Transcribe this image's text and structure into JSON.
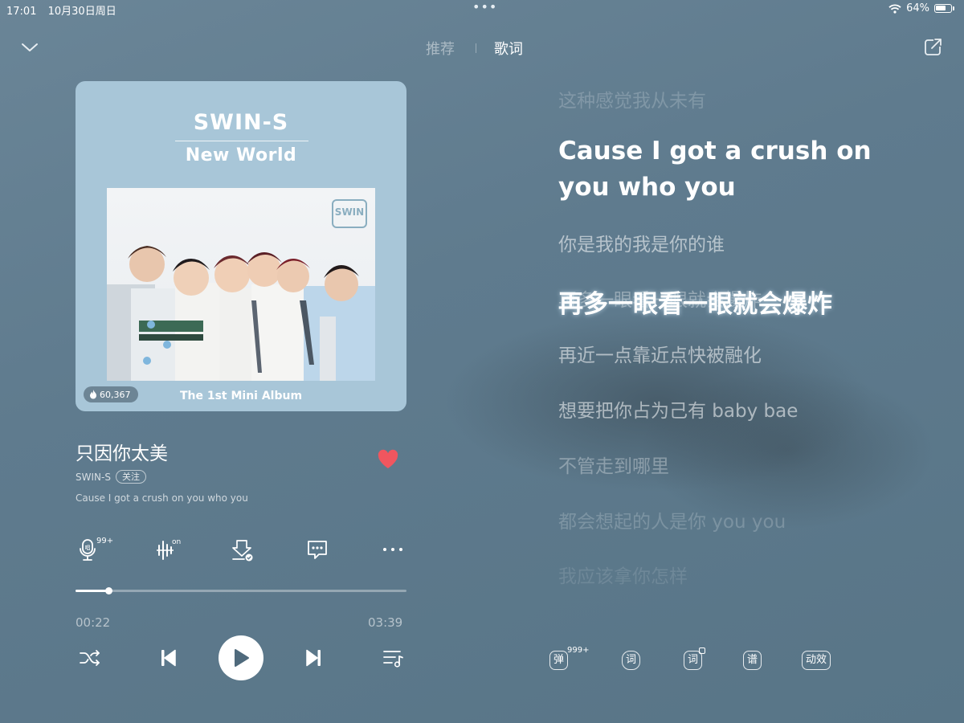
{
  "status_bar": {
    "time": "17:01",
    "date": "10月30日周日",
    "center_dots": "•••",
    "battery": "64%"
  },
  "header": {
    "tabs": [
      {
        "label": "推荐",
        "active": false
      },
      {
        "label": "歌词",
        "active": true
      }
    ]
  },
  "album": {
    "artist_text": "SWIN-S",
    "title_text": "New World",
    "logo_text": "SWIN",
    "subtitle_text": "The 1st Mini Album",
    "heat_count": "60,367",
    "bg_color": "#a8c6d8"
  },
  "song": {
    "title": "只因你太美",
    "artist": "SWIN-S",
    "follow_label": "关注",
    "current_lyric": "Cause I got a crush on you who you",
    "liked": true,
    "like_color": "#f0565f"
  },
  "actions": {
    "mic_badge": "99+",
    "sound_badge": "on"
  },
  "progress": {
    "current": "00:22",
    "total": "03:39",
    "fraction": 0.1
  },
  "lyrics": {
    "lines": [
      "这种感觉我从未有",
      "Cause I got a crush on you who you",
      "你是我的我是你的谁",
      "再多一眼看一眼就会爆炸",
      "再近一点靠近点快被融化",
      "想要把你占为己有 baby bae",
      "不管走到哪里",
      "都会想起的人是你 you you",
      "我应该拿你怎样"
    ]
  },
  "lyric_tools": {
    "danmaku_label": "弹",
    "danmaku_badge": "999+",
    "word_label": "词",
    "word2_label": "词",
    "score_label": "谱",
    "effect_label": "动效"
  }
}
